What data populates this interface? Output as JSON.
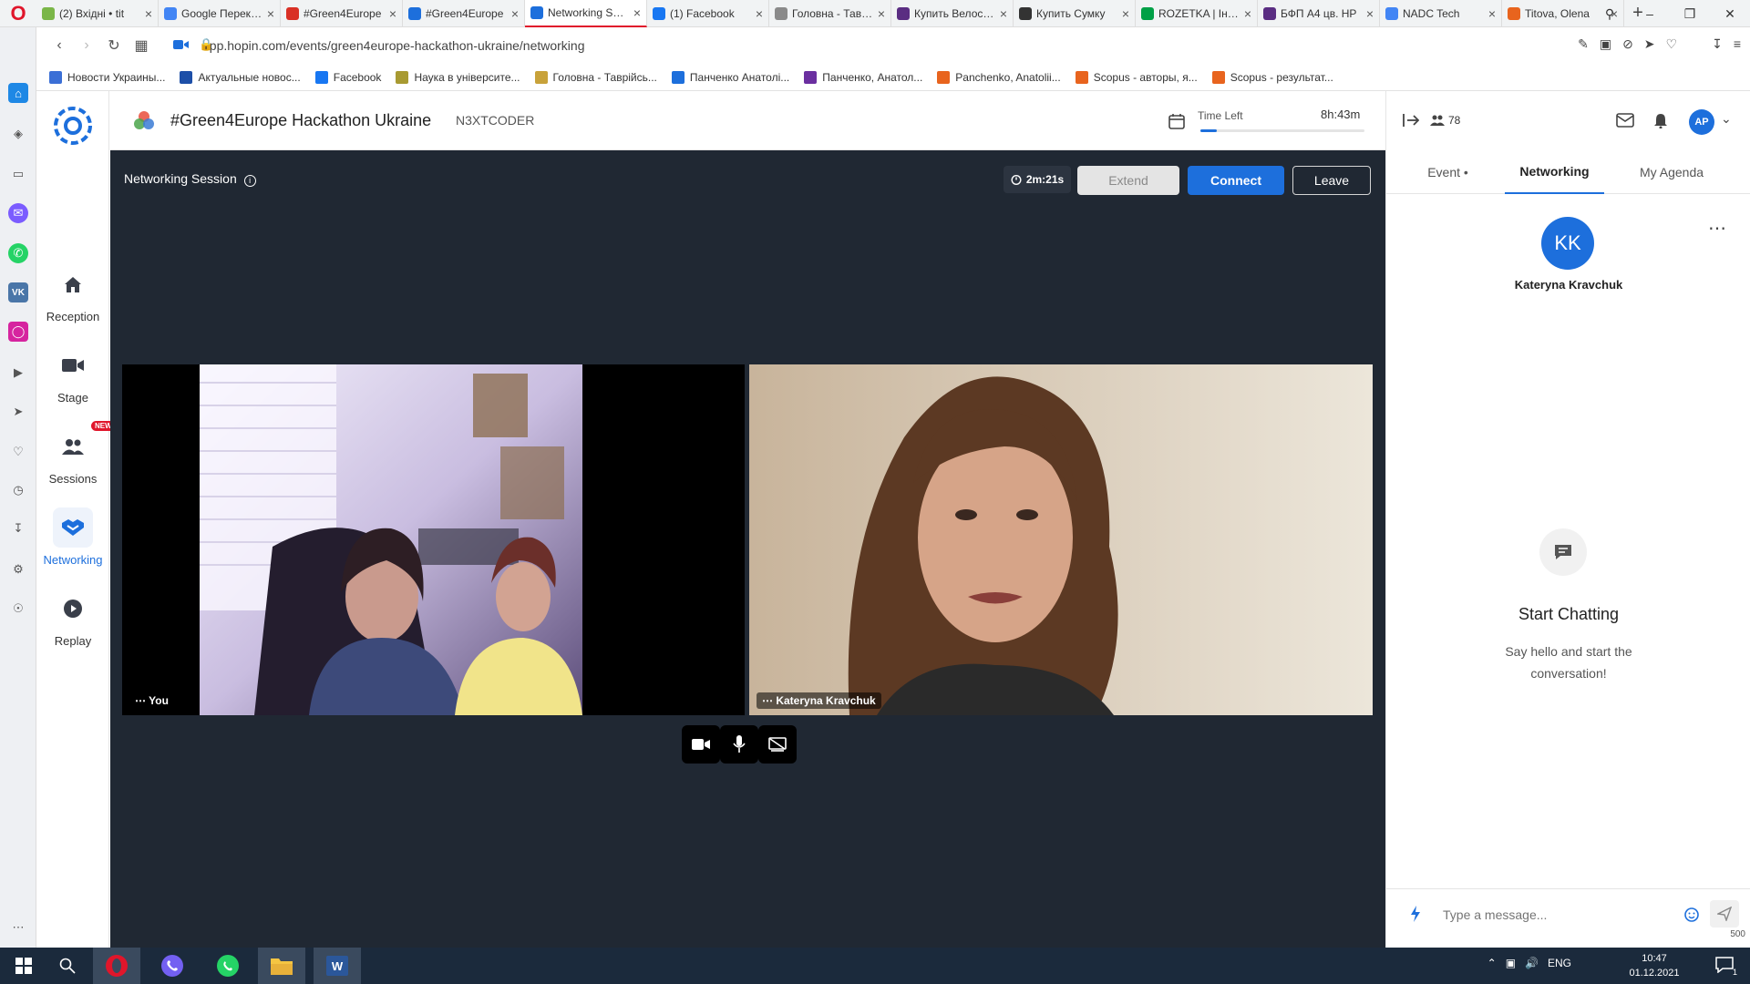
{
  "browser": {
    "tabs": [
      {
        "label": "(2) Вхідні • tit",
        "color": "#7ab648"
      },
      {
        "label": "Google Переклад",
        "color": "#4285f4"
      },
      {
        "label": "#Green4Europe",
        "color": "#d93025"
      },
      {
        "label": "#Green4Europe",
        "color": "#1d6fdc"
      },
      {
        "label": "Networking Session",
        "color": "#1d6fdc",
        "active": true
      },
      {
        "label": "(1) Facebook",
        "color": "#1877f2"
      },
      {
        "label": "Головна - Таврійський",
        "color": "#8a8a8a"
      },
      {
        "label": "Купить Велосипед",
        "color": "#5a2d82"
      },
      {
        "label": "Купить Сумку",
        "color": "#333333"
      },
      {
        "label": "ROZETKA | Інтернет",
        "color": "#00a046"
      },
      {
        "label": "БФП А4 цв. HP",
        "color": "#5a2d82"
      },
      {
        "label": "NADC Tech",
        "color": "#4285f4"
      },
      {
        "label": "Titova, Olena",
        "color": "#e8641e"
      }
    ],
    "url": "app.hopin.com/events/green4europe-hackathon-ukraine/networking",
    "bookmarks": [
      {
        "label": "Новости Украины...",
        "color": "#3b6fd6"
      },
      {
        "label": "Актуальные новос...",
        "color": "#1d4fa8"
      },
      {
        "label": "Facebook",
        "color": "#1877f2"
      },
      {
        "label": "Наука в університе...",
        "color": "#a89a32"
      },
      {
        "label": "Головна - Таврійсь...",
        "color": "#c8a23a"
      },
      {
        "label": "Панченко Анатолі...",
        "color": "#1d6fdc"
      },
      {
        "label": "Панченко, Анатол...",
        "color": "#6b2fa0"
      },
      {
        "label": "Panchenko, Anatolii...",
        "color": "#e8641e"
      },
      {
        "label": "Scopus - авторы, я...",
        "color": "#e8641e"
      },
      {
        "label": "Scopus - результат...",
        "color": "#e8641e"
      }
    ]
  },
  "nav": {
    "reception": "Reception",
    "stage": "Stage",
    "sessions": "Sessions",
    "sessions_badge": "NEW",
    "networking": "Networking",
    "replay": "Replay"
  },
  "header": {
    "title": "#Green4Europe Hackathon Ukraine",
    "organizer": "N3XTCODER",
    "time_left_label": "Time Left",
    "time_left_value": "8h:43m",
    "time_progress": 0.1
  },
  "session": {
    "title": "Networking Session",
    "timer": "2m:21s",
    "extend_label": "Extend",
    "connect_label": "Connect",
    "leave_label": "Leave",
    "you_label": "You",
    "partner_label": "Kateryna Kravchuk"
  },
  "panel": {
    "attendee_count": "78",
    "user_initials": "AP",
    "tabs": {
      "event": "Event •",
      "networking": "Networking",
      "agenda": "My Agenda"
    },
    "partner_initials": "KK",
    "partner_name": "Kateryna Kravchuk",
    "chat_title": "Start Chatting",
    "chat_subtitle": "Say hello and start the conversation!",
    "message_placeholder": "Type a message...",
    "char_limit": "500"
  },
  "taskbar": {
    "language": "ENG",
    "time": "10:47",
    "date": "01.12.2021",
    "notifications": "1"
  },
  "colors": {
    "accent": "#1d6fdc",
    "stage_bg": "#202833",
    "opera_red": "#e0162b"
  }
}
